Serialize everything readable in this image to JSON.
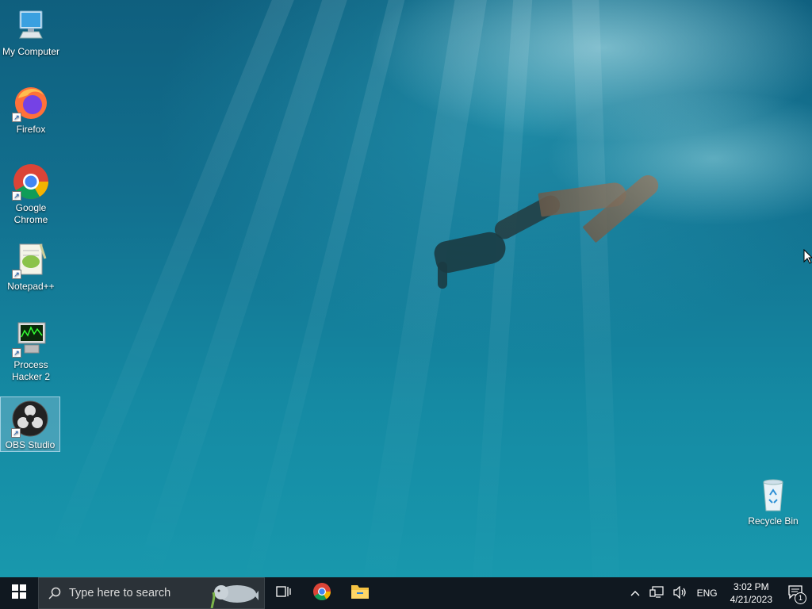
{
  "desktop": {
    "icons": [
      {
        "label": "My Computer",
        "icon": "computer-icon",
        "shortcut": false
      },
      {
        "label": "Firefox",
        "icon": "firefox-icon",
        "shortcut": true
      },
      {
        "label": "Google Chrome",
        "icon": "chrome-icon",
        "shortcut": true
      },
      {
        "label": "Notepad++",
        "icon": "notepadpp-icon",
        "shortcut": true
      },
      {
        "label": "Process Hacker 2",
        "icon": "process-hacker-icon",
        "shortcut": true
      },
      {
        "label": "OBS Studio",
        "icon": "obs-icon",
        "shortcut": true,
        "selected": true
      }
    ],
    "recycle_bin": {
      "label": "Recycle Bin",
      "icon": "recycle-bin-icon"
    }
  },
  "taskbar": {
    "start_icon": "windows-start-icon",
    "search": {
      "placeholder": "Type here to search",
      "icon": "search-icon"
    },
    "task_view_icon": "task-view-icon",
    "pinned": [
      {
        "name": "Google Chrome",
        "icon": "chrome-icon"
      },
      {
        "name": "File Explorer",
        "icon": "file-explorer-icon"
      }
    ],
    "tray": {
      "show_hidden_icon": "chevron-up-icon",
      "network_icon": "network-icon",
      "volume_icon": "volume-icon",
      "language": "ENG",
      "time": "3:02 PM",
      "date": "4/21/2023",
      "notification_count": "1"
    }
  },
  "colors": {
    "taskbar": "#101820",
    "search_box": "#2b3238",
    "windows_blue": "#1e90ff"
  }
}
